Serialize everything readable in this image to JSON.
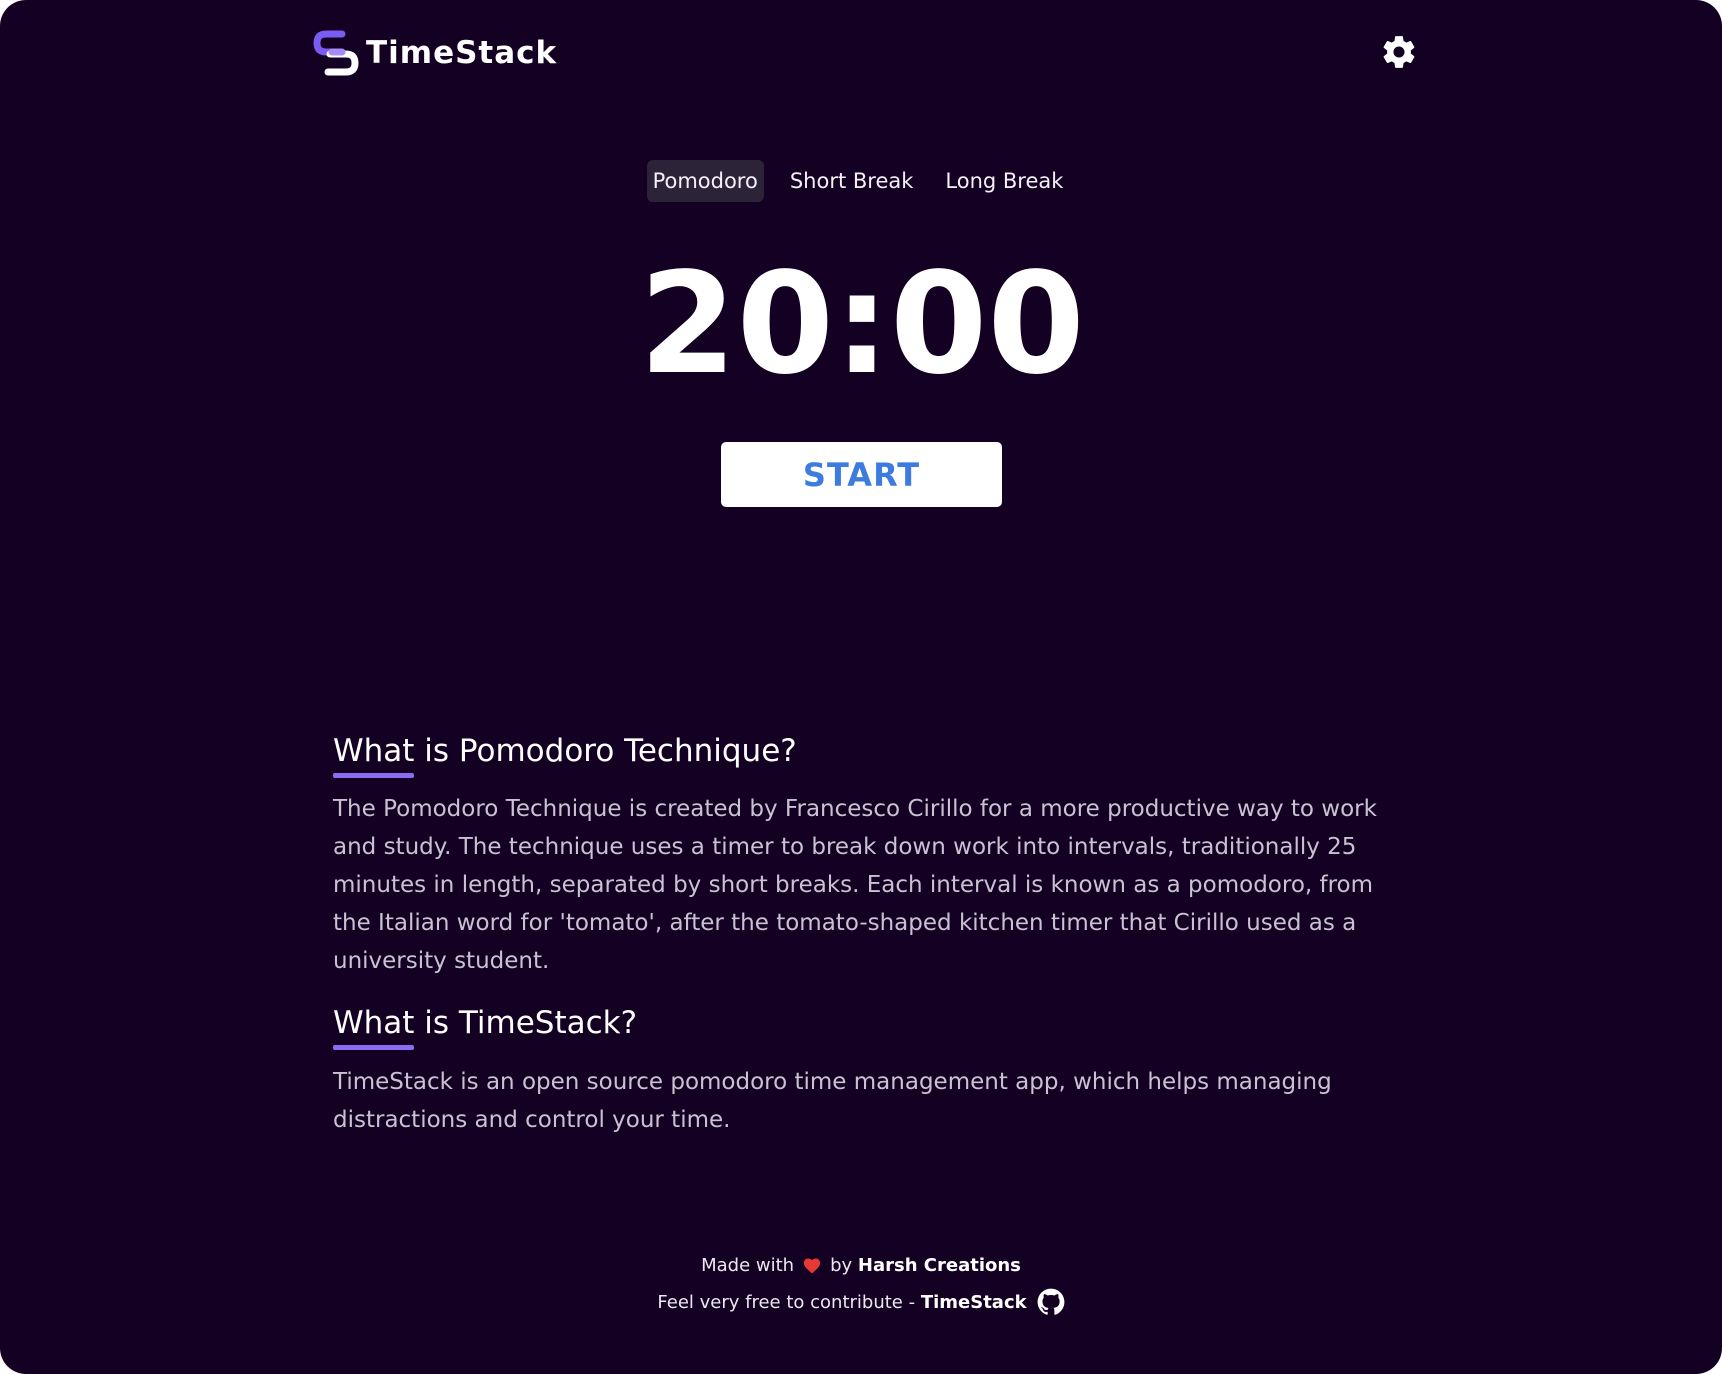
{
  "app": {
    "name": "TimeStack"
  },
  "header": {
    "logo_icon": "timestack-s-logo-icon",
    "settings_icon": "gear-icon"
  },
  "tabs": [
    {
      "label": "Pomodoro",
      "active": true
    },
    {
      "label": "Short Break",
      "active": false
    },
    {
      "label": "Long Break",
      "active": false
    }
  ],
  "timer": {
    "display": "20:00"
  },
  "controls": {
    "start_label": "START"
  },
  "info": {
    "sections": [
      {
        "title": "What is Pomodoro Technique?",
        "body": "The Pomodoro Technique is created by Francesco Cirillo for a more productive way to work and study. The technique uses a timer to break down work into intervals, traditionally 25 minutes in length, separated by short breaks. Each interval is known as a pomodoro, from the Italian word for 'tomato', after the tomato-shaped kitchen timer that Cirillo used as a university student."
      },
      {
        "title": "What is TimeStack?",
        "body": "TimeStack is an open source pomodoro time management app, which helps managing distractions and control your time."
      }
    ]
  },
  "footer": {
    "made_with": "Made with",
    "by": "by",
    "author": "Harsh Creations",
    "contribute": "Feel very free to contribute -",
    "repo": "TimeStack",
    "heart_icon": "heart-icon",
    "github_icon": "github-icon"
  },
  "colors": {
    "background": "#130022",
    "accent": "#8b6cf0",
    "start_text": "#3d7bdf",
    "heart": "#e53935",
    "active_tab": "#2c2338"
  }
}
